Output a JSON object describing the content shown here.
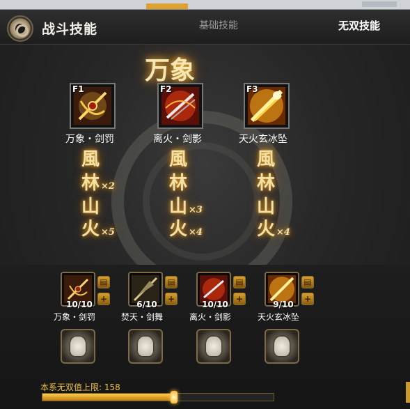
{
  "header": {
    "title": "战斗技能",
    "tabs": [
      {
        "label": "基础技能",
        "active": false
      },
      {
        "label": "无双技能",
        "active": true
      }
    ]
  },
  "combo_title": "万象",
  "skills": [
    {
      "key": "F1",
      "name": "万象・剑罚",
      "icon": "cross-blade-icon",
      "combo": [
        {
          "glyph": "風",
          "mult": ""
        },
        {
          "glyph": "林",
          "mult": "×2"
        },
        {
          "glyph": "山",
          "mult": ""
        },
        {
          "glyph": "火",
          "mult": "×5"
        }
      ]
    },
    {
      "key": "F2",
      "name": "离火・剑影",
      "icon": "fire-blade-icon",
      "combo": [
        {
          "glyph": "風",
          "mult": ""
        },
        {
          "glyph": "林",
          "mult": ""
        },
        {
          "glyph": "山",
          "mult": "×3"
        },
        {
          "glyph": "火",
          "mult": "×4"
        }
      ]
    },
    {
      "key": "F3",
      "name": "天火玄冰坠",
      "icon": "flame-strike-icon",
      "combo": [
        {
          "glyph": "風",
          "mult": ""
        },
        {
          "glyph": "林",
          "mult": ""
        },
        {
          "glyph": "山",
          "mult": ""
        },
        {
          "glyph": "火",
          "mult": "×4"
        }
      ]
    }
  ],
  "slots": [
    {
      "name": "万象・剑罚",
      "level": "10/10",
      "icon": "cross-blade-icon"
    },
    {
      "name": "焚天・剑舞",
      "level": "6/10",
      "icon": "spear-icon"
    },
    {
      "name": "离火・剑影",
      "level": "10/10",
      "icon": "fire-blade-icon"
    },
    {
      "name": "天火玄冰坠",
      "level": "9/10",
      "icon": "flame-strike-icon"
    }
  ],
  "limit": {
    "label": "本系无双值上限: 158",
    "fill_fraction": 0.57
  },
  "colors": {
    "gold": "#f0c040",
    "accent": "#ffb020"
  }
}
